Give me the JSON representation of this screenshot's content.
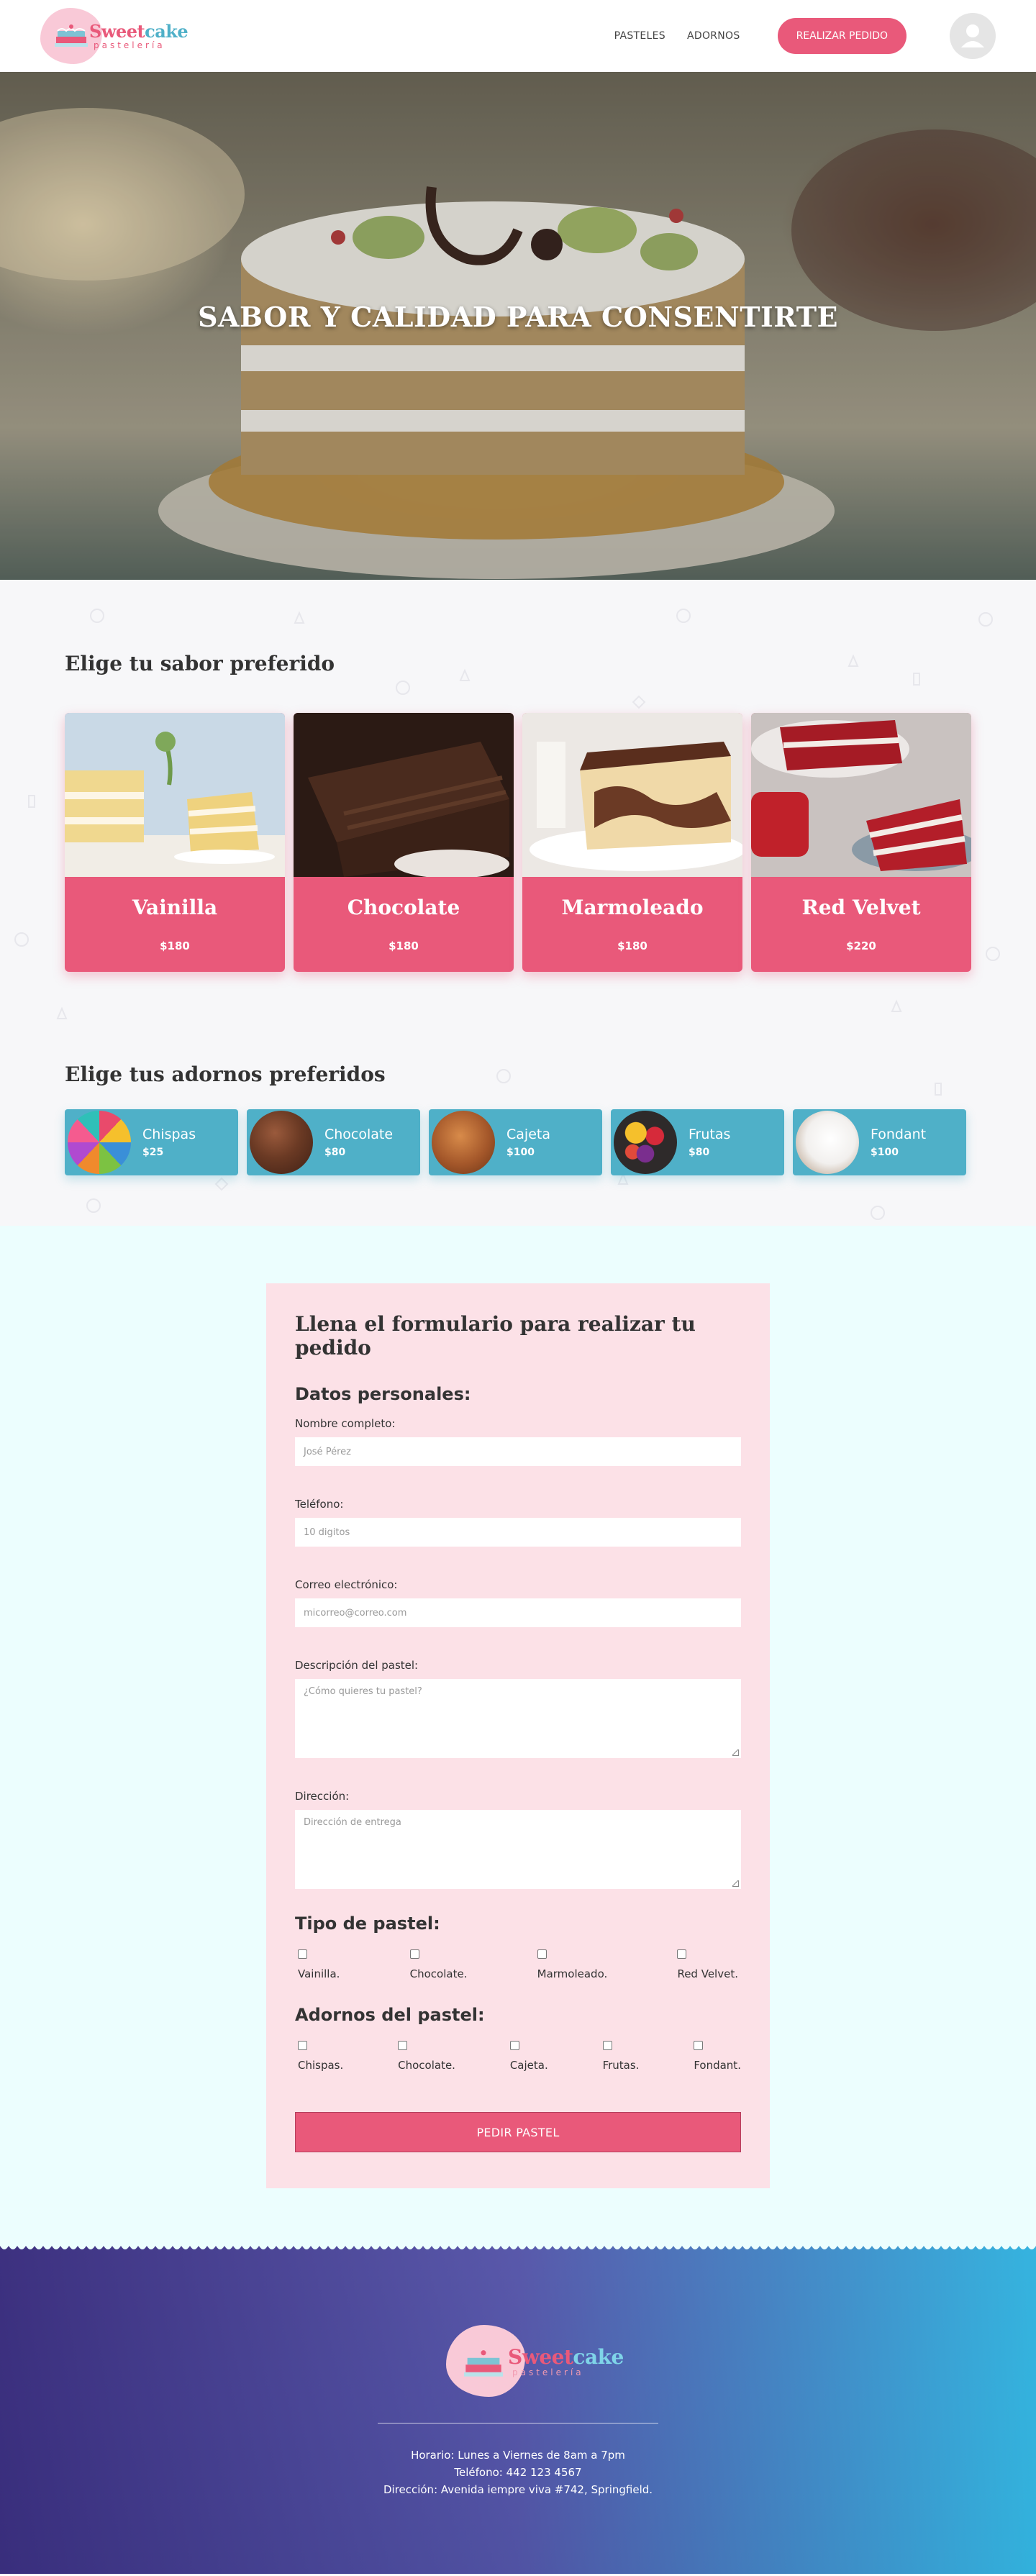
{
  "brand": {
    "name_part1": "Sweet",
    "name_part2": "cake",
    "tagline": "pastelería"
  },
  "nav": {
    "links": [
      "PASTELES",
      "ADORNOS"
    ],
    "cta": "REALIZAR PEDIDO"
  },
  "hero": {
    "title": "SABOR Y CALIDAD PARA CONSENTIRTE"
  },
  "flavors_section": {
    "title": "Elige tu sabor preferido",
    "items": [
      {
        "name": "Vainilla",
        "price": "$180"
      },
      {
        "name": "Chocolate",
        "price": "$180"
      },
      {
        "name": "Marmoleado",
        "price": "$180"
      },
      {
        "name": "Red Velvet",
        "price": "$220"
      }
    ]
  },
  "toppings_section": {
    "title": "Elige tus adornos preferidos",
    "items": [
      {
        "name": "Chispas",
        "price": "$25"
      },
      {
        "name": "Chocolate",
        "price": "$80"
      },
      {
        "name": "Cajeta",
        "price": "$100"
      },
      {
        "name": "Frutas",
        "price": "$80"
      },
      {
        "name": "Fondant",
        "price": "$100"
      }
    ]
  },
  "form": {
    "title": "Llena el formulario para realizar tu pedido",
    "personal_heading": "Datos personales:",
    "name_label": "Nombre completo:",
    "name_placeholder": "José Pérez",
    "phone_label": "Teléfono:",
    "phone_placeholder": "10 digitos",
    "email_label": "Correo electrónico:",
    "email_placeholder": "micorreo@correo.com",
    "desc_label": "Descripción del pastel:",
    "desc_placeholder": "¿Cómo quieres tu pastel?",
    "address_label": "Dirección:",
    "address_placeholder": "Dirección de entrega",
    "type_heading": "Tipo de pastel:",
    "types": [
      "Vainilla.",
      "Chocolate.",
      "Marmoleado.",
      "Red Velvet."
    ],
    "toppings_heading": "Adornos del pastel:",
    "toppings": [
      "Chispas.",
      "Chocolate.",
      "Cajeta.",
      "Frutas.",
      "Fondant."
    ],
    "submit": "PEDIR PASTEL"
  },
  "footer": {
    "hours": "Horario: Lunes a Viernes de 8am a 7pm",
    "phone": "Teléfono: 442 123 4567",
    "address": "Dirección: Avenida iempre viva #742, Springfield."
  },
  "colors": {
    "pink": "#e9597a",
    "teal": "#4fb0c8",
    "form_bg": "#fce1e7",
    "section_bg": "#ecfefe"
  }
}
